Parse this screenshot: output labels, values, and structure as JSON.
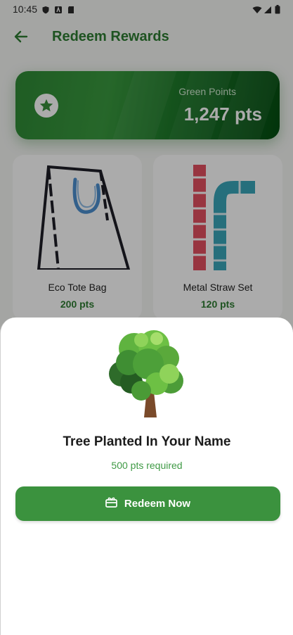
{
  "status_bar": {
    "time": "10:45"
  },
  "app_bar": {
    "title": "Redeem Rewards"
  },
  "points_card": {
    "label": "Green Points",
    "value": "1,247 pts"
  },
  "rewards": [
    {
      "name": "Eco Tote Bag",
      "points": "200 pts",
      "icon": "tote-bag-icon"
    },
    {
      "name": "Metal Straw Set",
      "points": "120 pts",
      "icon": "straw-icon"
    }
  ],
  "sheet": {
    "title": "Tree Planted In Your Name",
    "required": "500 pts required",
    "button_label": "Redeem Now",
    "icon": "tree-icon"
  },
  "colors": {
    "brand": "#2e7d32",
    "button": "#3b923e",
    "scrim": "rgba(0,0,0,0.33)"
  }
}
